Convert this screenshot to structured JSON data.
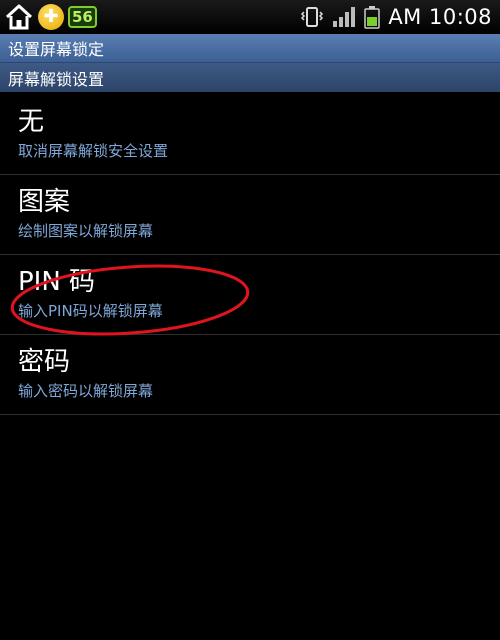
{
  "status_bar": {
    "app_icon_symbol": "✚",
    "badge_count": "56",
    "time": "AM 10:08",
    "icons": [
      "home-icon",
      "app-icon",
      "badge-icon",
      "vibrate-icon",
      "signal-icon",
      "battery-icon"
    ]
  },
  "header": {
    "title": "设置屏幕锁定"
  },
  "section": {
    "title": "屏幕解锁设置"
  },
  "options": [
    {
      "title": "无",
      "desc": "取消屏幕解锁安全设置"
    },
    {
      "title": "图案",
      "desc": "绘制图案以解锁屏幕"
    },
    {
      "title": "PIN 码",
      "desc": "输入PIN码以解锁屏幕"
    },
    {
      "title": "密码",
      "desc": "输入密码以解锁屏幕"
    }
  ],
  "colors": {
    "title_bar": "#4a6fa5",
    "description_text": "#7fa7d8",
    "highlight_ellipse": "#e0141e",
    "battery": "#7ccf2a"
  }
}
